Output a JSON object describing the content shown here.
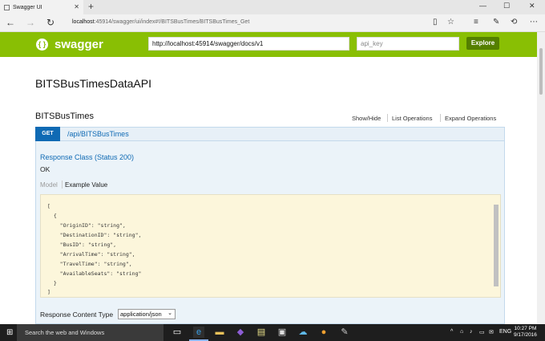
{
  "browser": {
    "tab_title": "Swagger UI",
    "new_tab": "+",
    "url_host": "localhost",
    "url_rest": ":45914/swagger/ui/index#!/BITSBusTimes/BITSBusTimes_Get",
    "window_controls": [
      "—",
      "☐",
      "✕"
    ]
  },
  "swagger_header": {
    "brand": "swagger",
    "logo_glyph": "{ }",
    "url_value": "http://localhost:45914/swagger/docs/v1",
    "api_key_placeholder": "api_key",
    "explore_label": "Explore"
  },
  "page": {
    "api_title": "BITSBusTimesDataAPI",
    "resource": {
      "name": "BITSBusTimes",
      "ops": [
        "Show/Hide",
        "List Operations",
        "Expand Operations"
      ]
    },
    "operation": {
      "method": "GET",
      "path": "/api/BITSBusTimes",
      "response_class": "Response Class (Status 200)",
      "status_text": "OK",
      "model_tab": "Model",
      "example_tab": "Example Value",
      "code_lines": [
        "[",
        "  {",
        "    \"OriginID\": \"string\",",
        "    \"DestinationID\": \"string\",",
        "    \"BusID\": \"string\",",
        "    \"ArrivalTime\": \"string\",",
        "    \"TravelTime\": \"string\",",
        "    \"AvailableSeats\": \"string\"",
        "  }",
        "]"
      ],
      "content_type_label": "Response Content Type",
      "content_type_value": "application/json"
    }
  },
  "taskbar": {
    "search_placeholder": "Search the web and Windows",
    "language": "ENG",
    "time": "10:27 PM",
    "date": "9/17/2016"
  },
  "colors": {
    "swagger_green": "#89bf04",
    "get_blue": "#0f6ab4",
    "explore_green": "#547f00"
  }
}
